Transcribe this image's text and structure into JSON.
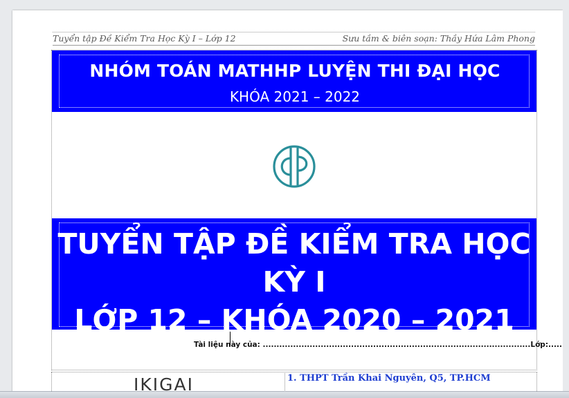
{
  "header": {
    "left_text": "Tuyển tập Đề Kiểm Tra Học Kỳ I – Lớp 12",
    "right_text": "Sưu tầm & biên soạn: Thầy Hứa Lâm Phong"
  },
  "banner_top": {
    "title": "NHÓM TOÁN MATHHP LUYỆN THI ĐẠI HỌC",
    "course": "KHÓA 2021 – 2022"
  },
  "logo": {
    "icon": "hp-monogram-logo-icon",
    "color": "#2a8f9a"
  },
  "banner_main": {
    "line1": "TUYỂN TẬP ĐỀ KIỂM TRA HỌC",
    "line2": "KỲ I",
    "line3": "LỚP 12 – KHÓA 2020 – 2021"
  },
  "owner_field": {
    "text": "Tài liệu này của: .................................................................................................Lớp:.............."
  },
  "bottom": {
    "brand": "IKIGAI",
    "school_item": "1. THPT Trần Khai Nguyên, Q5, TP.HCM"
  },
  "colors": {
    "banner_blue": "#0000ff",
    "school_text": "#1f3fd1"
  }
}
